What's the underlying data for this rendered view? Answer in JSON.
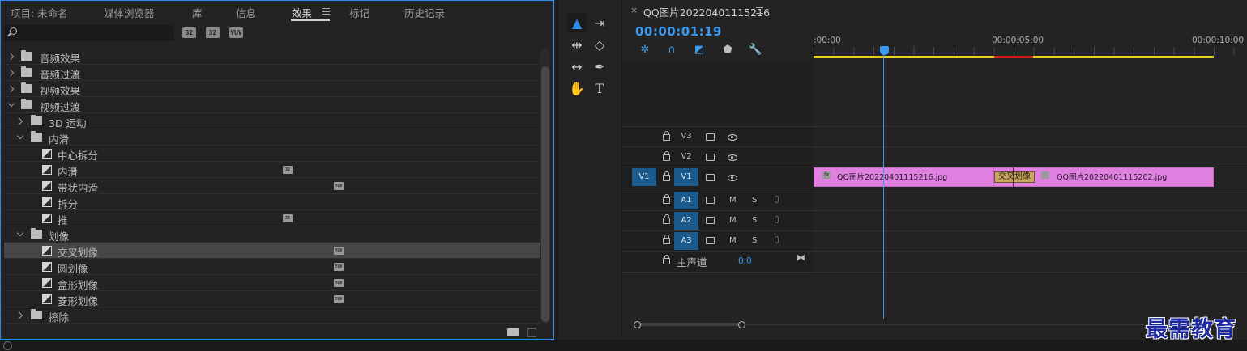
{
  "effects_panel": {
    "tabs": [
      {
        "label": "项目: 未命名",
        "active": false
      },
      {
        "label": "媒体浏览器",
        "active": false
      },
      {
        "label": "库",
        "active": false
      },
      {
        "label": "信息",
        "active": false
      },
      {
        "label": "效果",
        "active": true
      },
      {
        "label": "标记",
        "active": false
      },
      {
        "label": "历史记录",
        "active": false
      }
    ],
    "search": {
      "value": "",
      "placeholder": ""
    },
    "filter_buttons": [
      "32",
      "32",
      "YUV"
    ],
    "tree": [
      {
        "label": "音频效果",
        "type": "folder",
        "expanded": false,
        "level": 0
      },
      {
        "label": "音频过渡",
        "type": "folder",
        "expanded": false,
        "level": 0
      },
      {
        "label": "视频效果",
        "type": "folder",
        "expanded": false,
        "level": 0
      },
      {
        "label": "视频过渡",
        "type": "folder",
        "expanded": true,
        "level": 0
      },
      {
        "label": "3D 运动",
        "type": "folder",
        "expanded": false,
        "level": 1
      },
      {
        "label": "内滑",
        "type": "folder",
        "expanded": true,
        "level": 1
      },
      {
        "label": "中心拆分",
        "type": "effect",
        "level": 2,
        "badge": ""
      },
      {
        "label": "内滑",
        "type": "effect",
        "level": 2,
        "badge": "32"
      },
      {
        "label": "带状内滑",
        "type": "effect",
        "level": 2,
        "badge": "YUV"
      },
      {
        "label": "拆分",
        "type": "effect",
        "level": 2,
        "badge": ""
      },
      {
        "label": "推",
        "type": "effect",
        "level": 2,
        "badge": "32"
      },
      {
        "label": "划像",
        "type": "folder",
        "expanded": true,
        "level": 1
      },
      {
        "label": "交叉划像",
        "type": "effect",
        "level": 2,
        "badge": "YUV",
        "selected": true
      },
      {
        "label": "圆划像",
        "type": "effect",
        "level": 2,
        "badge": "YUV"
      },
      {
        "label": "盒形划像",
        "type": "effect",
        "level": 2,
        "badge": "YUV"
      },
      {
        "label": "菱形划像",
        "type": "effect",
        "level": 2,
        "badge": "YUV"
      },
      {
        "label": "擦除",
        "type": "folder",
        "expanded": false,
        "level": 1
      }
    ]
  },
  "tools": [
    {
      "icon": "selection-tool-icon",
      "glyph": "▲",
      "active": true
    },
    {
      "icon": "track-select-tool-icon",
      "glyph": "⇥",
      "active": false
    },
    {
      "icon": "ripple-edit-tool-icon",
      "glyph": "⇹",
      "active": false
    },
    {
      "icon": "razor-tool-icon",
      "glyph": "◇",
      "active": false
    },
    {
      "icon": "slip-tool-icon",
      "glyph": "↔",
      "active": false
    },
    {
      "icon": "pen-tool-icon",
      "glyph": "✒",
      "active": false
    },
    {
      "icon": "hand-tool-icon",
      "glyph": "✋",
      "active": false
    },
    {
      "icon": "type-tool-icon",
      "glyph": "T",
      "active": false
    }
  ],
  "timeline": {
    "close_glyph": "×",
    "sequence_title": "QQ图片20220401115216",
    "timecode": "00:00:01:19",
    "ruler_labels": [
      ":00:00",
      "00:00:05:00",
      "00:00:10:00"
    ],
    "video_tracks": [
      {
        "target": "",
        "name": "V3"
      },
      {
        "target": "",
        "name": "V2"
      },
      {
        "target": "V1",
        "name": "V1"
      }
    ],
    "audio_tracks": [
      {
        "name": "A1",
        "mute": "M",
        "solo": "S"
      },
      {
        "name": "A2",
        "mute": "M",
        "solo": "S"
      },
      {
        "name": "A3",
        "mute": "M",
        "solo": "S"
      }
    ],
    "master": {
      "label": "主声道",
      "value": "0.0"
    },
    "clips": [
      {
        "name": "QQ图片20220401115216.jpg",
        "badge": "fx"
      },
      {
        "name": "QQ图片20220401115202.jpg",
        "badge": ""
      }
    ],
    "transition_label": "交叉划像"
  },
  "watermark": "最需教育",
  "colors": {
    "accent": "#2d8ceb",
    "clip": "#e081e1",
    "work_area": "#e6d21c",
    "render_red": "#d62020",
    "transition": "#c8a860"
  }
}
